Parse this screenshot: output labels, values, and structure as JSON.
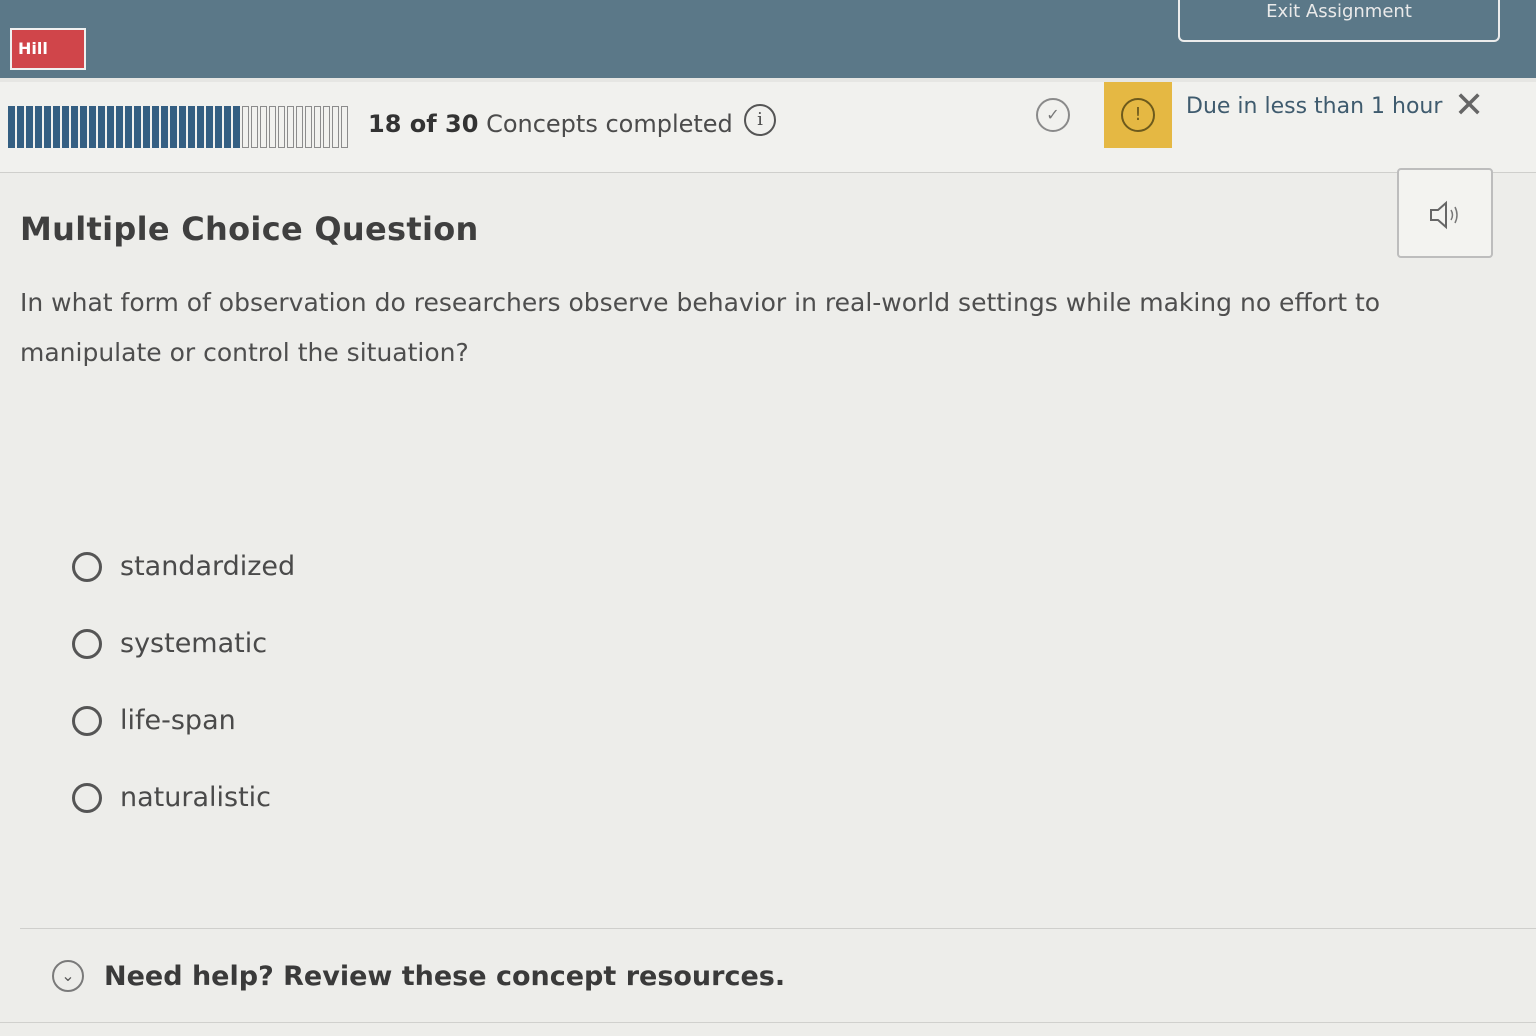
{
  "header": {
    "logo_text": "Hill",
    "exit_label": "Exit Assignment"
  },
  "progress": {
    "completed": 18,
    "total": 30,
    "label_count": "18 of 30",
    "label_rest": " Concepts completed",
    "info_icon": "info-icon"
  },
  "status": {
    "due_text": "Due in less than 1 hour",
    "check_icon": "check-circle-icon",
    "alert_icon": "alert-icon",
    "alert_color": "#e5b843",
    "close_icon": "close-icon"
  },
  "question": {
    "type_title": "Multiple Choice Question",
    "text": "In what form of observation do researchers observe behavior in real-world settings while making no effort to manipulate or control the situation?",
    "audio_icon": "speaker-icon",
    "options": [
      {
        "label": "standardized"
      },
      {
        "label": "systematic"
      },
      {
        "label": "life-span"
      },
      {
        "label": "naturalistic"
      }
    ]
  },
  "help": {
    "text": "Need help? Review these concept resources.",
    "icon": "chevron-down-icon"
  }
}
